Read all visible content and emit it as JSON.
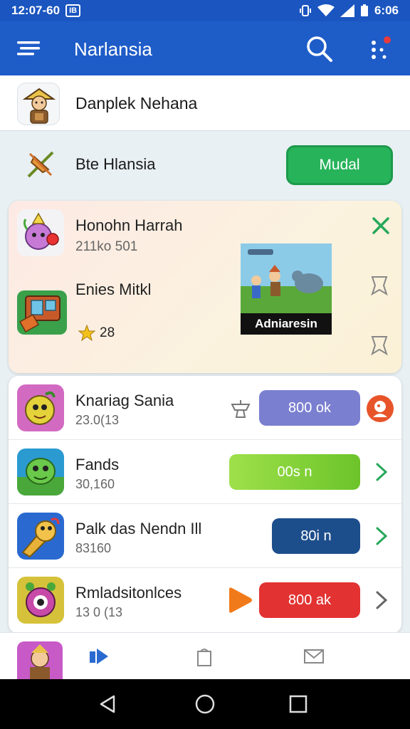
{
  "status_bar": {
    "time": "12:07-60",
    "badge": "IB",
    "battery_text": "6:06"
  },
  "app_bar": {
    "title": "Narlansia",
    "icons": [
      "menu-icon",
      "search-icon",
      "more-vert-icon"
    ]
  },
  "header": {
    "name": "Danplek Nehana"
  },
  "tool_row": {
    "label": "Bte Hlansia",
    "button_label": "Mudal",
    "button_color": "#27b35a"
  },
  "featured": {
    "item1": {
      "name": "Honohn Harrah",
      "sub": "211ko 501"
    },
    "item2": {
      "name": "Enies Mitkl",
      "rating": "28"
    },
    "banner_caption": "Adniaresin"
  },
  "list": [
    {
      "name": "Knariag Sania",
      "sub": "23.0(13",
      "button": "800 ok",
      "button_color": "#7a7fd0"
    },
    {
      "name": "Fands",
      "sub": "30,160",
      "button": "00s n",
      "button_color": "#8fd43a"
    },
    {
      "name": "Palk das Nendn Ill",
      "sub": "83160",
      "button": "80i n",
      "button_color": "#1d4e8c"
    },
    {
      "name": "Rmladsitonlces",
      "sub": "13 0 (13",
      "button": "800 ak",
      "button_color": "#e23232"
    }
  ],
  "bottom_nav": {
    "items": [
      "play-icon",
      "bag-icon",
      "mail-icon"
    ]
  },
  "system_nav": {
    "items": [
      "back-icon",
      "home-icon",
      "recents-icon"
    ]
  }
}
